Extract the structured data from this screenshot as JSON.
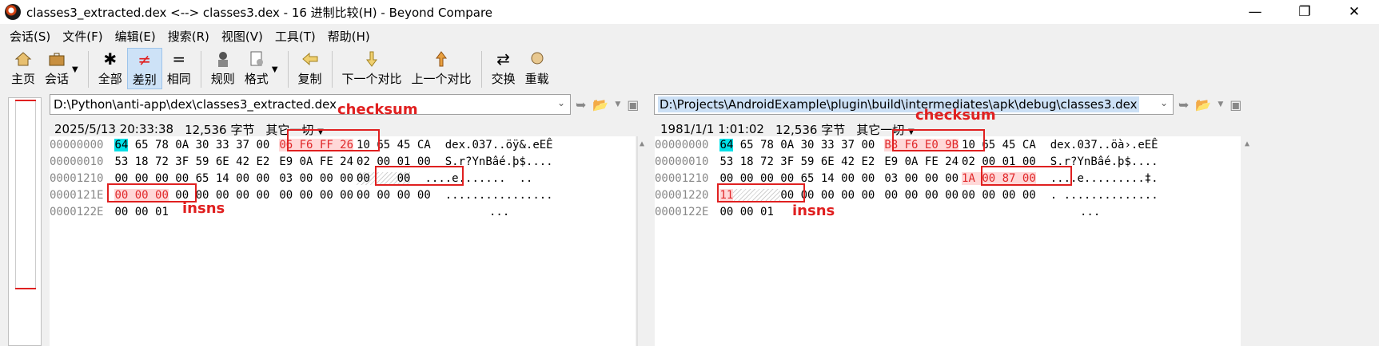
{
  "window": {
    "title": "classes3_extracted.dex <--> classes3.dex - 16 进制比较(H) - Beyond Compare",
    "minimize": "—",
    "maximize": "❐",
    "close": "✕"
  },
  "menu": [
    "会话(S)",
    "文件(F)",
    "编辑(E)",
    "搜索(R)",
    "视图(V)",
    "工具(T)",
    "帮助(H)"
  ],
  "toolbar": {
    "home": "主页",
    "session": "会话",
    "all": "全部",
    "diff": "差别",
    "same": "相同",
    "rules": "规则",
    "format": "格式",
    "copy": "复制",
    "next_diff": "下一个对比",
    "prev_diff": "上一个对比",
    "swap": "交换",
    "reload": "重载"
  },
  "left": {
    "path": "D:\\Python\\anti-app\\dex\\classes3_extracted.dex",
    "date": "2025/5/13 20:33:38",
    "size": "12,536 字节",
    "encoding": "其它一切",
    "rows": [
      {
        "offset": "00000000",
        "hex": "64 65 78 0A 30 33 37 00",
        "hex2a": "06 F6 FF 26",
        "hex2b": "10 65 45 CA",
        "text": "dex.037..öÿ&.eEÊ"
      },
      {
        "offset": "00000010",
        "hex": "53 18 72 3F 59 6E 42 E2",
        "hex2a": "E9 0A FE 24",
        "hex2b": "02 00 01 00",
        "text": "S.r?YnBâé.þ$...."
      },
      {
        "offset": "00001210",
        "hex": "00 00 00 00 65 14 00 00",
        "hex2a": "03 00 00 00",
        "hex2b": "00    00",
        "text": "....e.......  .."
      },
      {
        "offset": "0000121E",
        "hex": "00 00 00 00 00 00 00 00",
        "hex2a": "00 00 00 00",
        "hex2b": "00 00 00 00",
        "text": "................"
      },
      {
        "offset": "0000122E",
        "hex": "00 00 01",
        "hex2a": "",
        "hex2b": "",
        "text": "..."
      }
    ],
    "annot_checksum": "checksum",
    "annot_insns": "insns"
  },
  "right": {
    "path": "D:\\Projects\\AndroidExample\\plugin\\build\\intermediates\\apk\\debug\\classes3.dex",
    "date": "1981/1/1 1:01:02",
    "size": "12,536 字节",
    "encoding": "其它一切",
    "rows": [
      {
        "offset": "00000000",
        "hex": "64 65 78 0A 30 33 37 00",
        "hex2a": "B8 F6 E0 9B",
        "hex2b": "10 65 45 CA",
        "text": "dex.037..öà›.eEÊ"
      },
      {
        "offset": "00000010",
        "hex": "53 18 72 3F 59 6E 42 E2",
        "hex2a": "E9 0A FE 24",
        "hex2b": "02 00 01 00",
        "text": "S.r?YnBâé.þ$...."
      },
      {
        "offset": "00001210",
        "hex": "00 00 00 00 65 14 00 00",
        "hex2a": "03 00 00 00",
        "hex2b": "1A 00 87 00",
        "text": "....e.........‡."
      },
      {
        "offset": "00001220",
        "hex": "11       00 00 00 00 00",
        "hex2a": "00 00 00 00",
        "hex2b": "00 00 00 00",
        "text": ". .............."
      },
      {
        "offset": "0000122E",
        "hex": "00 00 01",
        "hex2a": "",
        "hex2b": "",
        "text": "..."
      }
    ],
    "annot_checksum": "checksum",
    "annot_insns": "insns"
  },
  "colors": {
    "accent_diff": "#e0282a",
    "highlight_cyan": "#00e0e8",
    "annot_red": "#e02020"
  }
}
